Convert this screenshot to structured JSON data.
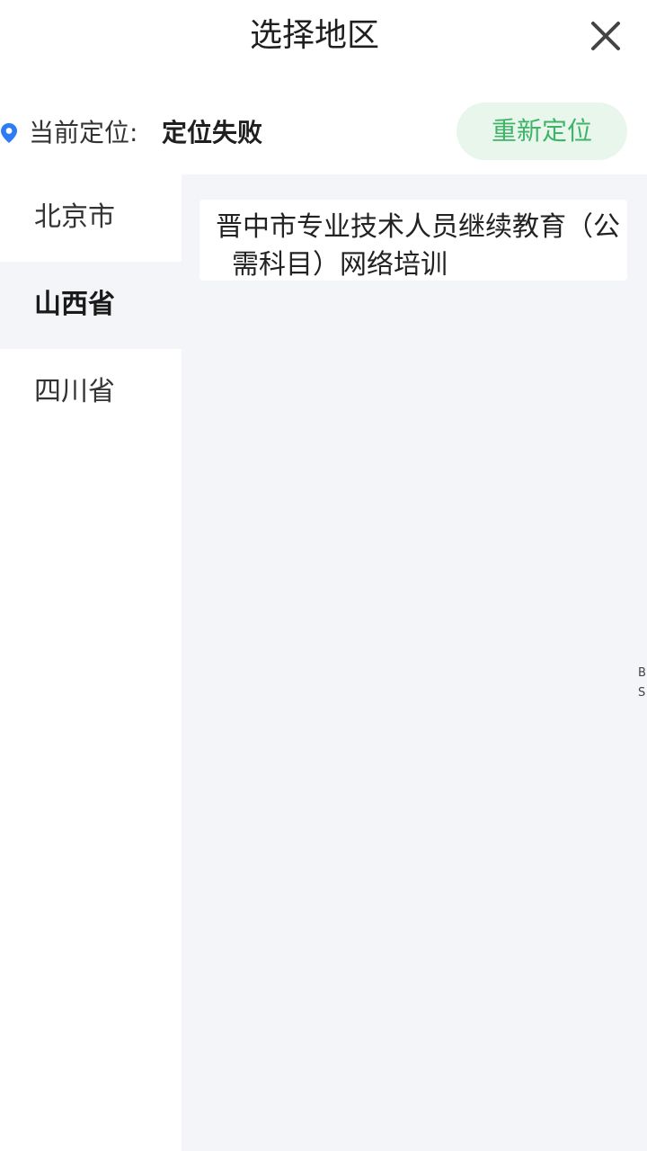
{
  "header": {
    "title": "选择地区",
    "close_icon": "close-icon"
  },
  "location": {
    "icon": "location-pin-icon",
    "label": "当前定位:",
    "status": "定位失败",
    "relocate_label": "重新定位",
    "relocate_bg": "#e8f6ec",
    "relocate_color": "#3fb468",
    "pin_color": "#2e7bf6"
  },
  "sidebar": {
    "items": [
      {
        "label": "北京市",
        "active": false
      },
      {
        "label": "山西省",
        "active": true
      },
      {
        "label": "四川省",
        "active": false
      }
    ]
  },
  "content": {
    "courses": [
      {
        "title": "晋中市专业技术人员继续教育（公需科目）网络培训"
      }
    ],
    "edge_text": [
      "B",
      "S"
    ]
  }
}
